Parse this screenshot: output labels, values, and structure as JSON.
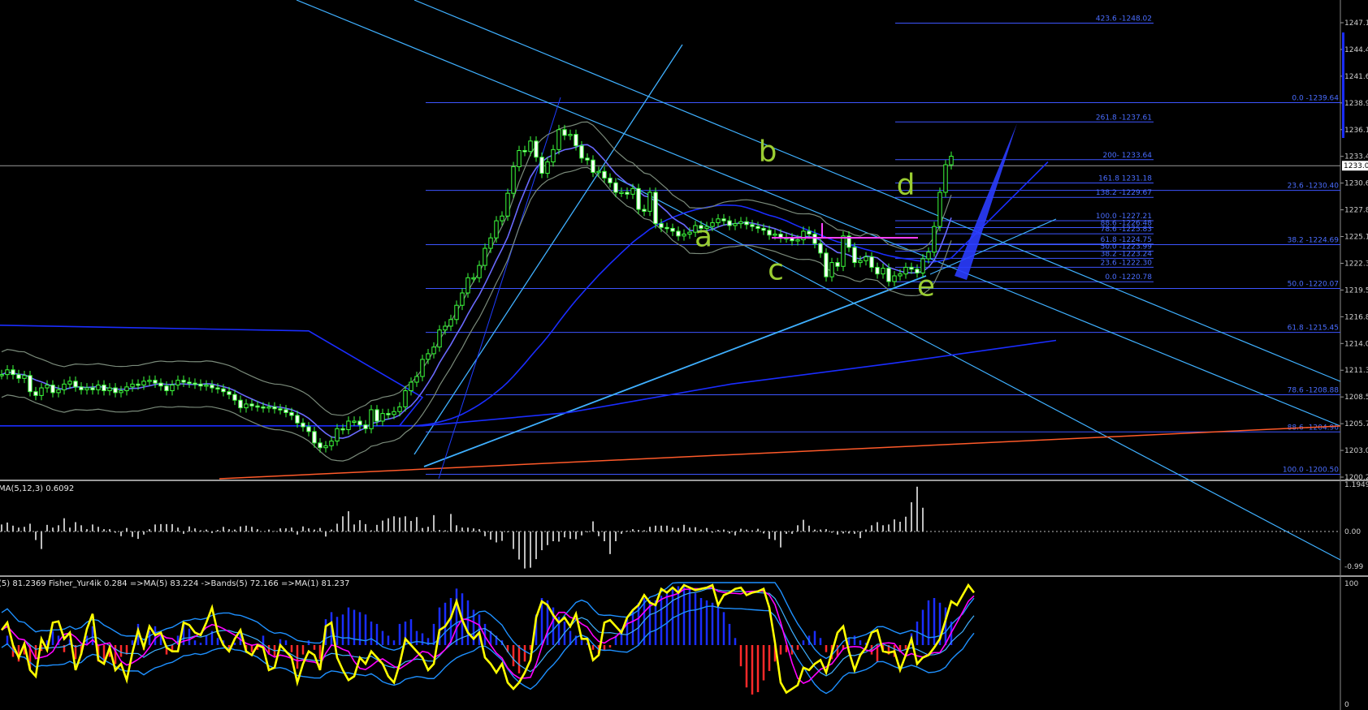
{
  "chart_data": [
    {
      "type": "candlestick",
      "title": "",
      "ylim": [
        1200.2,
        1247.1
      ],
      "price_axis_labels": [
        "1247.1",
        "1244.4",
        "1241.6",
        "1238.9",
        "1236.1",
        "1233.4",
        "1230.6",
        "1227.8",
        "1225.1",
        "1222.3",
        "1219.5",
        "1216.8",
        "1214.0",
        "1211.3",
        "1208.5",
        "1205.7",
        "1203.0",
        "1200.2"
      ],
      "current_price_label": "1233.0",
      "current_price": 1233.0,
      "wave_labels": [
        {
          "text": "a",
          "price": 1224.5
        },
        {
          "text": "b",
          "price": 1233.5
        },
        {
          "text": "c",
          "price": 1221.0
        },
        {
          "text": "d",
          "price": 1230.0
        },
        {
          "text": "e",
          "price": 1219.3
        }
      ],
      "fib_levels_left": [
        {
          "label": "0.0 -1239.64",
          "price": 1239.64
        },
        {
          "label": "23.6 -1230.40",
          "price": 1230.4
        },
        {
          "label": "38.2 -1224.69",
          "price": 1224.69
        },
        {
          "label": "50.0 -1220.07",
          "price": 1220.07
        },
        {
          "label": "61.8 -1215.45",
          "price": 1215.45
        },
        {
          "label": "78.6 -1208.88",
          "price": 1208.88
        },
        {
          "label": "88.6 -1204.96",
          "price": 1204.96
        },
        {
          "label": "100.0 -1200.50",
          "price": 1200.5
        }
      ],
      "fib_levels_right": [
        {
          "label": "423.6 -1248.02",
          "price": 1248.02
        },
        {
          "label": "261.8 -1237.61",
          "price": 1237.61
        },
        {
          "label": "200- 1233.64",
          "price": 1233.64
        },
        {
          "label": "161.8 1231.18",
          "price": 1231.18
        },
        {
          "label": "138.2 -1229.67",
          "price": 1229.67
        },
        {
          "label": "100.0 -1227.21",
          "price": 1227.21
        },
        {
          "label": "88.6 -1226.48",
          "price": 1226.48
        },
        {
          "label": "78.6 -1225.83",
          "price": 1225.83
        },
        {
          "label": "61.8 -1224.75",
          "price": 1224.75
        },
        {
          "label": "50.0 -1223.99",
          "price": 1223.99
        },
        {
          "label": "38.2 -1223.24",
          "price": 1223.24
        },
        {
          "label": "23.6 -1222.30",
          "price": 1222.3
        },
        {
          "label": "0.0 -1220.78",
          "price": 1220.78
        }
      ],
      "closes": [
        1211,
        1211.5,
        1211,
        1210.6,
        1210.9,
        1209.2,
        1208.8,
        1209.6,
        1209.9,
        1209.1,
        1209.4,
        1210,
        1210.3,
        1209.7,
        1209.4,
        1209.6,
        1209.4,
        1209.9,
        1209.3,
        1209.6,
        1209.1,
        1209.3,
        1209.7,
        1210,
        1209.9,
        1210.3,
        1210.4,
        1210.1,
        1209.8,
        1209.3,
        1209.9,
        1210.4,
        1210.2,
        1210.1,
        1210,
        1209.8,
        1209.9,
        1209.6,
        1209.5,
        1209.2,
        1208.9,
        1208.3,
        1207.5,
        1207.9,
        1207.7,
        1207.6,
        1207.5,
        1207.6,
        1207.4,
        1207.3,
        1207.0,
        1206.7,
        1205.9,
        1205.5,
        1205.0,
        1203.8,
        1203.3,
        1203.5,
        1204.0,
        1205.3,
        1205.2,
        1206.1,
        1206.1,
        1205.7,
        1205.3,
        1207.3,
        1206.1,
        1206.9,
        1206.8,
        1207.1,
        1207.6,
        1209.3,
        1210.2,
        1210.8,
        1212.6,
        1213.2,
        1213.9,
        1215.7,
        1216.1,
        1216.8,
        1218.3,
        1219.6,
        1221.2,
        1221.2,
        1222.5,
        1224.3,
        1225.4,
        1227.2,
        1227.7,
        1230.1,
        1232.9,
        1234.6,
        1234.5,
        1235.6,
        1233.9,
        1232.2,
        1233.4,
        1234.7,
        1236.8,
        1236.2,
        1236.3,
        1235.1,
        1233.8,
        1233.6,
        1232.3,
        1232.4,
        1231.7,
        1231.2,
        1230.2,
        1230.2,
        1230.0,
        1230.6,
        1228.4,
        1228.2,
        1230.2,
        1226.9,
        1226.5,
        1226.4,
        1226.1,
        1225.6,
        1225.8,
        1226.0,
        1226.7,
        1226.4,
        1226.6,
        1227.0,
        1227.4,
        1227.2,
        1226.7,
        1226.9,
        1227.1,
        1226.8,
        1226.6,
        1226.4,
        1226.2,
        1225.7,
        1225.8,
        1225.4,
        1225.4,
        1225.1,
        1225.2,
        1226.1,
        1225.8,
        1224.8,
        1223.8,
        1221.3,
        1222.8,
        1222.4,
        1225.6,
        1224.4,
        1222.8,
        1223.0,
        1223.4,
        1222.3,
        1221.6,
        1222.2,
        1220.8,
        1221.4,
        1221.6,
        1222.3,
        1222.1,
        1221.7,
        1223.2,
        1223.9,
        1226.6,
        1230.2,
        1233.1,
        1234.0
      ]
    },
    {
      "type": "bar",
      "title": "MA(5,12,3) 0.6092",
      "axis_labels": [
        "1.1949",
        "0.00",
        "-0.99"
      ],
      "ylim": [
        -0.99,
        1.1949
      ],
      "values": [
        0.18,
        0.23,
        0.15,
        0.1,
        0.12,
        0.2,
        -0.22,
        -0.45,
        0.17,
        0.1,
        0.16,
        0.34,
        0.1,
        0.24,
        0.16,
        0.06,
        0.18,
        0.12,
        0.06,
        0.06,
        -0.03,
        -0.12,
        0.09,
        -0.14,
        -0.19,
        -0.08,
        0.06,
        0.18,
        0.19,
        0.19,
        0.19,
        0.1,
        -0.06,
        0.13,
        0.08,
        0.03,
        0.05,
        -0.04,
        0.04,
        0.12,
        0.06,
        0.05,
        0.13,
        0.15,
        0.12,
        0.06,
        0.0,
        0.05,
        0.01,
        0.08,
        0.08,
        0.1,
        -0.08,
        0.13,
        0.08,
        0.05,
        0.09,
        -0.13,
        0.05,
        0.2,
        0.39,
        0.52,
        0.18,
        0.29,
        0.19,
        0.03,
        0.17,
        0.28,
        0.34,
        0.39,
        0.36,
        0.39,
        0.27,
        0.37,
        0.09,
        0.12,
        0.42,
        0.04,
        0.03,
        0.45,
        0.16,
        0.1,
        0.1,
        0.08,
        0.06,
        -0.12,
        -0.21,
        -0.28,
        -0.24,
        -0.02,
        -0.45,
        -0.72,
        -0.95,
        -0.93,
        -0.71,
        -0.48,
        -0.35,
        -0.25,
        -0.26,
        -0.15,
        -0.19,
        -0.2,
        -0.1,
        -0.02,
        0.26,
        -0.12,
        -0.25,
        -0.58,
        -0.25,
        -0.06,
        0.02,
        0.06,
        0.04,
        0.03,
        0.12,
        0.15,
        0.15,
        0.15,
        0.1,
        0.09,
        0.17,
        0.1,
        0.11,
        0.05,
        0.09,
        -0.03,
        0.04,
        0.05,
        -0.05,
        -0.1,
        0.07,
        0.05,
        0.03,
        0.07,
        -0.05,
        -0.19,
        -0.22,
        -0.41,
        -0.06,
        -0.06,
        0.16,
        0.3,
        0.15,
        0.05,
        0.05,
        0.06,
        -0.03,
        -0.08,
        -0.05,
        -0.05,
        -0.06,
        -0.17,
        0.05,
        0.16,
        0.24,
        0.16,
        0.18,
        0.31,
        0.25,
        0.38,
        0.75,
        1.15,
        0.61
      ]
    },
    {
      "type": "line",
      "title": "(5) 81.2369  Fisher_Yur4ik 0.284  =>MA(5) 83.224  ->Bands(5) 72.166  =>MA(1) 81.237",
      "axis_labels": [
        "100",
        "0"
      ],
      "ylim": [
        0,
        100
      ],
      "series": [
        {
          "name": "Fisher_Yur4ik",
          "color": "#ffff00"
        },
        {
          "name": "MA(5)",
          "color": "#ff00ff"
        },
        {
          "name": "Bands(5)",
          "color": "#1e90ff"
        }
      ],
      "fisher": [
        62,
        68,
        50,
        40,
        51,
        30,
        25,
        55,
        46,
        68,
        69,
        55,
        60,
        30,
        43,
        63,
        75,
        38,
        35,
        48,
        30,
        35,
        22,
        44,
        62,
        48,
        65,
        58,
        60,
        48,
        45,
        45,
        68,
        66,
        60,
        58,
        68,
        80,
        60,
        50,
        45,
        55,
        62,
        45,
        42,
        50,
        48,
        30,
        32,
        50,
        45,
        40,
        20,
        35,
        45,
        42,
        30,
        65,
        68,
        40,
        30,
        22,
        25,
        40,
        35,
        45,
        40,
        35,
        25,
        20,
        35,
        55,
        50,
        45,
        40,
        30,
        35,
        62,
        65,
        72,
        85,
        70,
        60,
        55,
        60,
        40,
        35,
        28,
        35,
        20,
        15,
        20,
        28,
        38,
        72,
        85,
        82,
        74,
        68,
        72,
        65,
        75,
        55,
        55,
        38,
        42,
        68,
        70,
        65,
        60,
        72,
        78,
        82,
        90,
        84,
        82,
        95,
        92,
        96,
        92,
        98,
        96,
        94,
        95,
        96,
        98,
        82,
        90,
        92,
        95,
        96,
        90,
        92,
        93,
        95,
        80,
        52,
        20,
        12,
        15,
        18,
        32,
        30,
        35,
        38,
        28,
        44,
        60,
        65,
        45,
        30,
        42,
        48,
        60,
        62,
        45,
        44,
        45,
        30,
        42,
        55,
        35,
        40,
        42,
        48,
        55,
        70,
        85,
        82,
        90,
        98,
        92
      ],
      "hist": [
        0,
        8,
        -10,
        -14,
        -8,
        -20,
        -12,
        -5,
        4,
        12,
        8,
        -6,
        5,
        -12,
        -8,
        8,
        16,
        -14,
        -16,
        -10,
        -16,
        -10,
        -8,
        4,
        18,
        -4,
        12,
        16,
        10,
        -8,
        -6,
        8,
        20,
        14,
        4,
        2,
        8,
        12,
        6,
        4,
        -4,
        2,
        10,
        -4,
        -6,
        -4,
        8,
        -8,
        -10,
        5,
        4,
        -6,
        -20,
        -8,
        4,
        -4,
        -12,
        22,
        28,
        24,
        26,
        32,
        30,
        28,
        26,
        20,
        18,
        12,
        8,
        4,
        18,
        20,
        22,
        12,
        10,
        6,
        18,
        32,
        36,
        40,
        48,
        44,
        38,
        30,
        26,
        18,
        12,
        8,
        4,
        -6,
        -18,
        -24,
        -14,
        -4,
        26,
        40,
        38,
        32,
        24,
        20,
        12,
        8,
        4,
        2,
        -4,
        -8,
        -4,
        -2,
        8,
        14,
        22,
        30,
        36,
        40,
        38,
        38,
        42,
        44,
        48,
        50,
        52,
        48,
        44,
        40,
        38,
        36,
        36,
        28,
        18,
        6,
        -18,
        -36,
        -42,
        -40,
        -30,
        -22,
        -14,
        -8,
        -6,
        -8,
        -4,
        4,
        8,
        12,
        6,
        -6,
        -12,
        -10,
        -4,
        6,
        8,
        4,
        2,
        -8,
        -14,
        -4,
        -8,
        -10,
        -6,
        -4,
        10,
        20,
        30,
        38,
        40,
        36,
        32,
        20
      ]
    }
  ]
}
